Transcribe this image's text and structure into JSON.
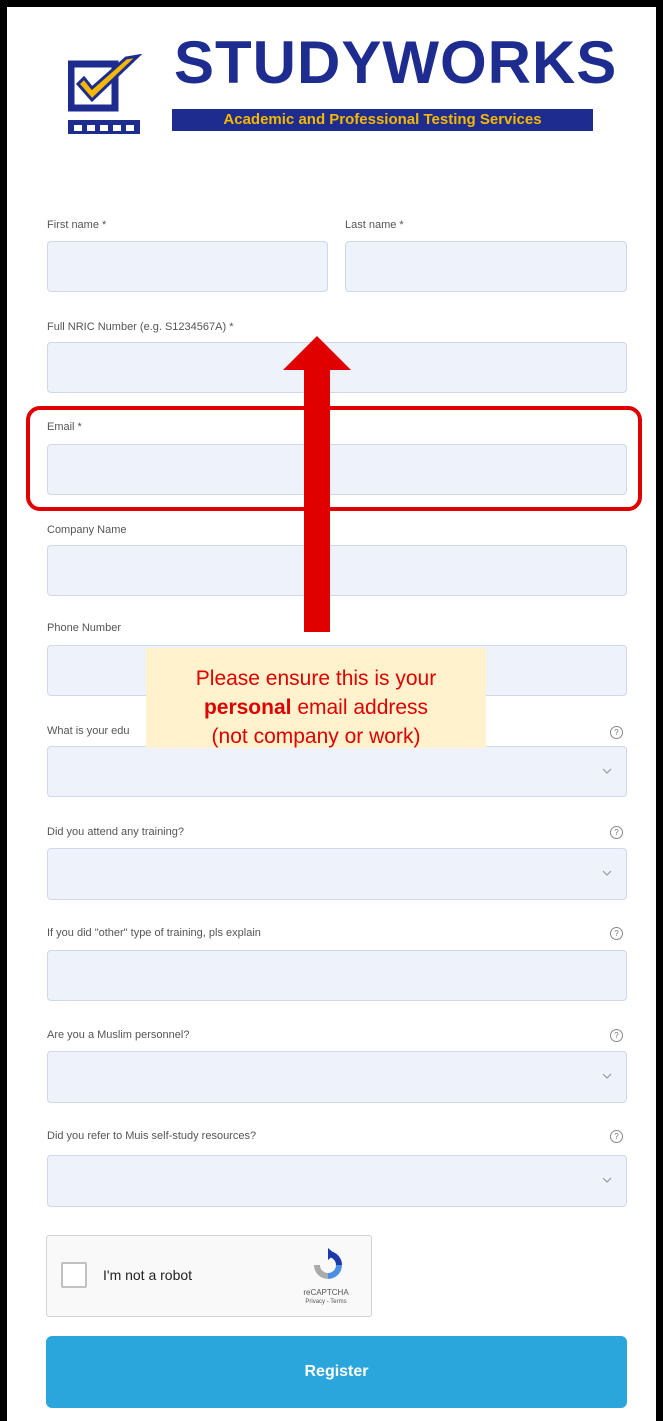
{
  "brand": {
    "name": "STUDYWORKS",
    "tagline": "Academic and Professional Testing Services",
    "colors": {
      "navy": "#1e2c8f",
      "gold": "#f5b800"
    }
  },
  "form": {
    "first_name_label": "First name *",
    "last_name_label": "Last name *",
    "nric_label": "Full NRIC Number (e.g. S1234567A) *",
    "email_label": "Email *",
    "company_label": "Company Name",
    "phone_label": "Phone Number",
    "education_label": "What is your edu",
    "training_label": "Did you attend any training?",
    "other_training_label": "If you did \"other\" type of training, pls explain",
    "muslim_label": "Are you a Muslim personnel?",
    "muis_label": "Did you refer to Muis self-study resources?",
    "help_icon": "?"
  },
  "annotation": {
    "line1": "Please ensure this is your",
    "bold": "personal",
    "line2_rest": " email address",
    "line3": "(not company or work)",
    "highlight_color": "#e00000",
    "callout_bg": "#fff2cc"
  },
  "recaptcha": {
    "label": "I'm not a robot",
    "brand": "reCAPTCHA",
    "links": "Privacy - Terms"
  },
  "submit": {
    "label": "Register",
    "color": "#2aa6dc"
  }
}
